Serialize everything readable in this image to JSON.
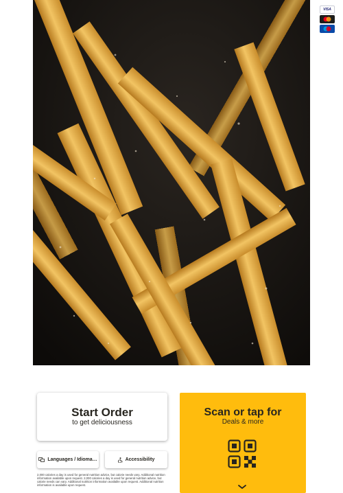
{
  "hero": {
    "image_alt": "",
    "icon": "fries-photo"
  },
  "payment_cards": [
    "VISA",
    "MasterCard",
    "Maestro"
  ],
  "start_order": {
    "title": "Start Order",
    "subtitle": "to get deliciousness"
  },
  "buttons": {
    "languages_label": "Languages / Idioma…",
    "accessibility_label": "Accessibility"
  },
  "disclaimer": "2,000 calories a day is used for general nutrition advice, but calorie needs vary. Additional nutrition information available upon request. 2,000 calories a day is used for general nutrition advice, but calorie needs can vary. Additional nutrition information available upon request. Additional nutrition information is available upon request.",
  "scan": {
    "title": "Scan or tap for",
    "subtitle": "Deals & more",
    "icon": "qr-code-icon",
    "chevron": "chevron-down-icon"
  },
  "colors": {
    "accent": "#ffbc0d",
    "text": "#27251f",
    "hero_bg": "#16130f"
  }
}
